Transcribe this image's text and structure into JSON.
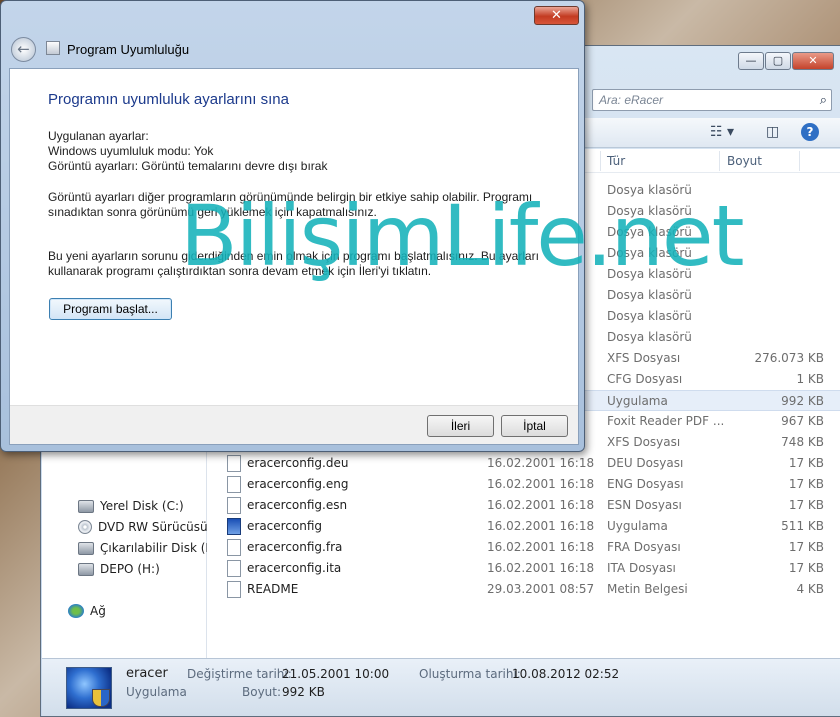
{
  "explorer": {
    "search_placeholder": "Ara: eRacer",
    "columns": {
      "type": "Tür",
      "size": "Boyut"
    },
    "nav": [
      {
        "label": "Yerel Disk (C:)",
        "icon": "hard-drive-icon"
      },
      {
        "label": "DVD RW Sürücüsü (I",
        "icon": "dvd-drive-icon"
      },
      {
        "label": "Çıkarılabilir Disk (F:)",
        "icon": "removable-drive-icon"
      },
      {
        "label": "DEPO (H:)",
        "icon": "hard-drive-icon"
      },
      {
        "label": "Ağ",
        "icon": "network-icon"
      }
    ],
    "rows_partial": [
      {
        "type": "Dosya klasörü",
        "size": ""
      },
      {
        "type": "Dosya klasörü",
        "size": ""
      },
      {
        "type": "Dosya klasörü",
        "size": ""
      },
      {
        "type": "Dosya klasörü",
        "size": ""
      },
      {
        "type": "Dosya klasörü",
        "size": ""
      },
      {
        "type": "Dosya klasörü",
        "size": ""
      },
      {
        "type": "Dosya klasörü",
        "size": ""
      },
      {
        "type": "Dosya klasörü",
        "size": ""
      },
      {
        "type": "XFS Dosyası",
        "size": "276.073 KB"
      },
      {
        "type": "CFG Dosyası",
        "size": "1 KB"
      },
      {
        "type": "Uygulama",
        "size": "992 KB"
      },
      {
        "type": "Foxit Reader PDF ...",
        "size": "967 KB"
      },
      {
        "type": "XFS Dosyası",
        "size": "748 KB"
      }
    ],
    "rows_full": [
      {
        "name": "eracerconfig.deu",
        "date": "16.02.2001 16:18",
        "type": "DEU Dosyası",
        "size": "17 KB"
      },
      {
        "name": "eracerconfig.eng",
        "date": "16.02.2001 16:18",
        "type": "ENG Dosyası",
        "size": "17 KB"
      },
      {
        "name": "eracerconfig.esn",
        "date": "16.02.2001 16:18",
        "type": "ESN Dosyası",
        "size": "17 KB"
      },
      {
        "name": "eracerconfig",
        "date": "16.02.2001 16:18",
        "type": "Uygulama",
        "size": "511 KB"
      },
      {
        "name": "eracerconfig.fra",
        "date": "16.02.2001 16:18",
        "type": "FRA Dosyası",
        "size": "17 KB"
      },
      {
        "name": "eracerconfig.ita",
        "date": "16.02.2001 16:18",
        "type": "ITA Dosyası",
        "size": "17 KB"
      },
      {
        "name": "README",
        "date": "29.03.2001 08:57",
        "type": "Metin Belgesi",
        "size": "4 KB"
      }
    ],
    "details": {
      "name": "eracer",
      "kind": "Uygulama",
      "modified_label": "Değiştirme tarihi:",
      "modified_value": "21.05.2001 10:00",
      "created_label": "Oluşturma tarihi:",
      "created_value": "10.08.2012 02:52",
      "size_label": "Boyut:",
      "size_value": "992 KB"
    }
  },
  "dialog": {
    "title": "Program Uyumluluğu",
    "heading": "Programın uyumluluk ayarlarını sına",
    "settings_lines": [
      "Uygulanan ayarlar:",
      "Windows uyumluluk modu: Yok",
      "Görüntü ayarları:  Görüntü temalarını devre dışı bırak"
    ],
    "para1_lines": [
      "Görüntü ayarları diğer programların görünümünde belirgin bir etkiye sahip olabilir. Programı",
      "sınadıktan sonra görünümü geri yüklemek için kapatmalısınız."
    ],
    "para2_lines": [
      "Bu yeni ayarların sorunu giderdiğinden emin olmak için programı başlatmalısınız. Bu ayarları",
      "kullanarak programı çalıştırdıktan sonra devam etmek için İleri'yi tıklatın."
    ],
    "start_button": "Programı başlat...",
    "next_button": "İleri",
    "cancel_button": "İptal"
  },
  "watermark": "BilişimLife.net"
}
